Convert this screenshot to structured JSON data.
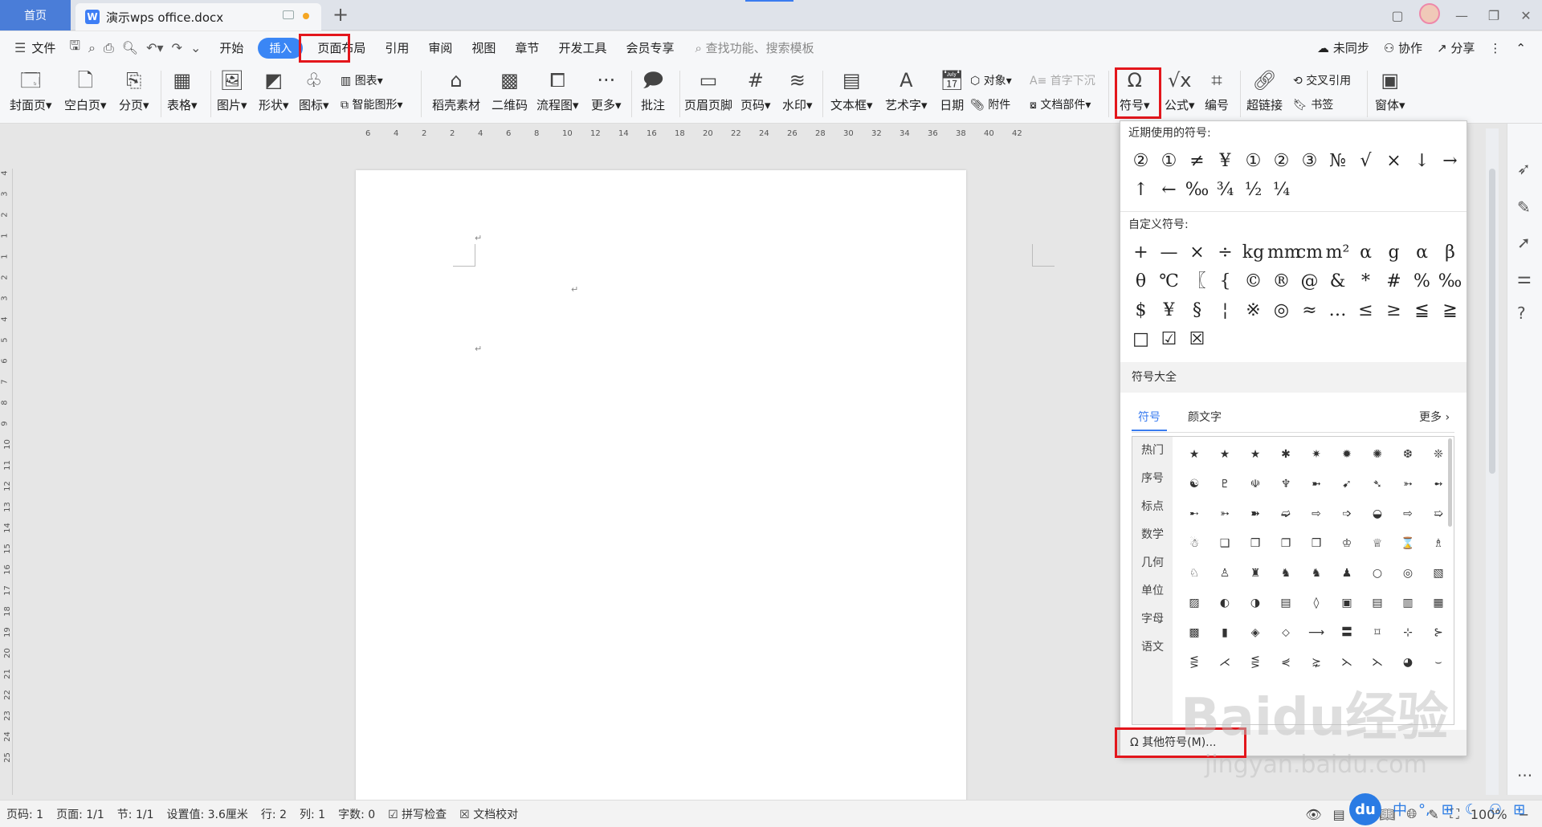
{
  "titlebar": {
    "home_tab": "首页",
    "doc_tab": "演示wps office.docx",
    "new_tab_icon": "plus-icon"
  },
  "menubar": {
    "file": "文件",
    "tabs": [
      "开始",
      "插入",
      "页面布局",
      "引用",
      "审阅",
      "视图",
      "章节",
      "开发工具",
      "会员专享"
    ],
    "search_placeholder": "查找功能、搜索模板",
    "sync": "未同步",
    "collab": "协作",
    "share": "分享"
  },
  "toolbar": {
    "cover": "封面页",
    "blank": "空白页",
    "break": "分页",
    "table": "表格",
    "picture": "图片",
    "shape": "形状",
    "icon": "图标",
    "chart": "图表",
    "smartart": "智能图形",
    "material": "稻壳素材",
    "qrcode": "二维码",
    "flowchart": "流程图",
    "more": "更多",
    "comment": "批注",
    "header_footer": "页眉页脚",
    "page_num": "页码",
    "watermark": "水印",
    "textbox": "文本框",
    "wordart": "艺术字",
    "date": "日期",
    "object": "对象",
    "attachment": "附件",
    "dropcap": "首字下沉",
    "docparts": "文档部件",
    "symbol": "符号",
    "formula": "公式",
    "numbering": "编号",
    "hyperlink": "超链接",
    "crossref": "交叉引用",
    "bookmark": "书签",
    "window": "窗体"
  },
  "ruler": {
    "h_ticks": [
      "6",
      "4",
      "2",
      "2",
      "4",
      "6",
      "8",
      "10",
      "12",
      "14",
      "16",
      "18",
      "20",
      "22",
      "24",
      "26",
      "28",
      "30",
      "32",
      "34",
      "36",
      "38",
      "40",
      "42"
    ],
    "v_ticks": [
      "4",
      "3",
      "2",
      "1",
      "1",
      "2",
      "3",
      "4",
      "5",
      "6",
      "7",
      "8",
      "9",
      "10",
      "11",
      "12",
      "13",
      "14",
      "15",
      "16",
      "17",
      "18",
      "19",
      "20",
      "21",
      "22",
      "23",
      "24",
      "25"
    ]
  },
  "symbol_panel": {
    "recent_title": "近期使用的符号:",
    "recent": [
      "②",
      "①",
      "≠",
      "¥",
      "①",
      "②",
      "③",
      "№",
      "√",
      "×",
      "↓",
      "→",
      "↑",
      "←",
      "‰",
      "¾",
      "½",
      "¼"
    ],
    "custom_title": "自定义符号:",
    "custom": [
      "+",
      "—",
      "×",
      "÷",
      "kg",
      "mm",
      "cm",
      "m²",
      "α",
      "g",
      "α",
      "β",
      "θ",
      "℃",
      "〖",
      "{",
      "©",
      "®",
      "@",
      "&",
      "*",
      "#",
      "%",
      "‰",
      "$",
      "¥",
      "§",
      "¦",
      "※",
      "◎",
      "≈",
      "…",
      "≤",
      "≥",
      "≦",
      "≧",
      "□",
      "☑",
      "☒"
    ],
    "all_title": "符号大全",
    "tab_symbols": "符号",
    "tab_kaomoji": "颜文字",
    "more": "更多",
    "categories": [
      "热门",
      "序号",
      "标点",
      "数学",
      "几何",
      "单位",
      "字母",
      "语文"
    ],
    "grid": [
      "★",
      "★",
      "★",
      "✱",
      "✷",
      "✹",
      "✺",
      "❆",
      "❊",
      "☯",
      "♇",
      "☫",
      "♆",
      "➼",
      "➹",
      "➴",
      "➳",
      "➻",
      "➸",
      "➳",
      "➽",
      "➫",
      "⇨",
      "➩",
      "◒",
      "⇨",
      "➯",
      "☃",
      "❑",
      "❒",
      "❐",
      "❒",
      "♔",
      "♕",
      "⌛",
      "♗",
      "♘",
      "♙",
      "♜",
      "♞",
      "♞",
      "♟",
      "○",
      "◎",
      "▧",
      "▨",
      "◐",
      "◑",
      "▤",
      "◊",
      "▣",
      "▤",
      "▥",
      "▦",
      "▩",
      "▮",
      "◈",
      "⬦",
      "⟶",
      "〓",
      "⌑",
      "⊹",
      "⊱",
      "⋚",
      "⋌",
      "⋚",
      "⋞",
      "⋩",
      "⋋",
      "⋋",
      "◕",
      "⌣"
    ],
    "other": "其他符号(M)..."
  },
  "statusbar": {
    "page": "页码: 1",
    "pages": "页面: 1/1",
    "section": "节: 1/1",
    "setting": "设置值: 3.6厘米",
    "row": "行: 2",
    "col": "列: 1",
    "words": "字数: 0",
    "spell": "拼写检查",
    "proof": "文档校对",
    "zoom": "100%"
  },
  "watermark": {
    "text": "Baidu经验",
    "url": "jingyan.baidu.com"
  },
  "ime": {
    "du": "du",
    "lang": "中"
  }
}
